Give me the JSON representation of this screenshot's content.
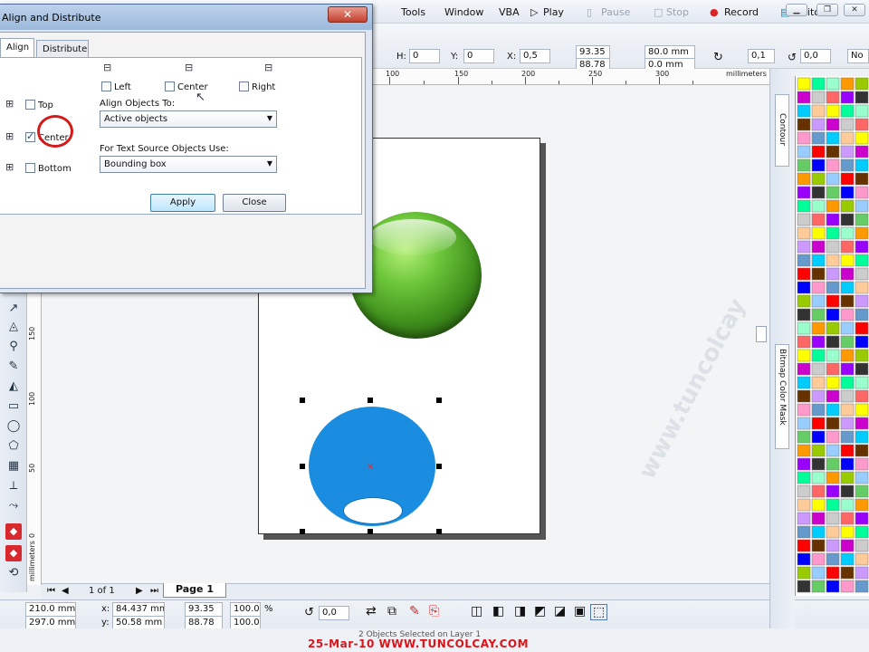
{
  "menu": {
    "items": [
      "Tools",
      "Window",
      "VBA",
      "Play",
      "Pause",
      "Stop",
      "Record",
      "Editor"
    ]
  },
  "propbar": {
    "hpos_label": "H:",
    "hpos": "0",
    "ypos_label": "Y:",
    "ypos": "0",
    "xsize_label": "X:",
    "xsize": "0,5",
    "scale_w": "93.35",
    "scale_h": "88.78",
    "size_w": "80.0 mm",
    "size_h": "0.0 mm",
    "spin1": "0,1",
    "angle": "0,0",
    "outline": "No"
  },
  "ruler": {
    "top_labels": [
      "100",
      "150",
      "200",
      "250",
      "300"
    ],
    "unit": "millimeters",
    "left_labels": [
      "150",
      "100",
      "50",
      "0"
    ],
    "left_unit": "millimeters"
  },
  "dialog": {
    "title": "Align and Distribute",
    "close": "✕",
    "tabs": [
      "Align",
      "Distribute"
    ],
    "h_options": [
      {
        "label": "Left",
        "checked": false
      },
      {
        "label": "Center",
        "checked": false
      },
      {
        "label": "Right",
        "checked": false
      }
    ],
    "v_options": [
      {
        "label": "Top",
        "checked": false
      },
      {
        "label": "Center",
        "checked": true
      },
      {
        "label": "Bottom",
        "checked": false
      }
    ],
    "align_to_label": "Align Objects To:",
    "align_to_value": "Active objects",
    "text_source_label": "For Text Source Objects Use:",
    "text_source_value": "Bounding box",
    "apply": "Apply",
    "close_button": "Close"
  },
  "dockers": {
    "contour": "Contour",
    "bitmap_mask": "Bitmap Color Mask"
  },
  "pagebar": {
    "page_count": "1 of 1",
    "page_tab": "Page 1"
  },
  "status": {
    "width": "210.0 mm",
    "height": "297.0 mm",
    "x": "84.437 mm",
    "y": "50.58 mm",
    "scale_x": "93.35",
    "scale_y": "88.78",
    "pct1": "100.0",
    "pct2": "100.0",
    "pct_unit": "%",
    "angle": "0,0",
    "selection_text": "2 Objects Selected on Layer 1"
  },
  "watermark": {
    "date_site": "25-Mar-10   WWW.TUNCOLCAY.COM",
    "diagonal": "www.tuncolcay"
  },
  "colors": {
    "accent_blue": "#1a8de0",
    "dialog_title": "#9cb9dc",
    "close_red": "#c5402d",
    "watermark_red": "#d8151b"
  }
}
